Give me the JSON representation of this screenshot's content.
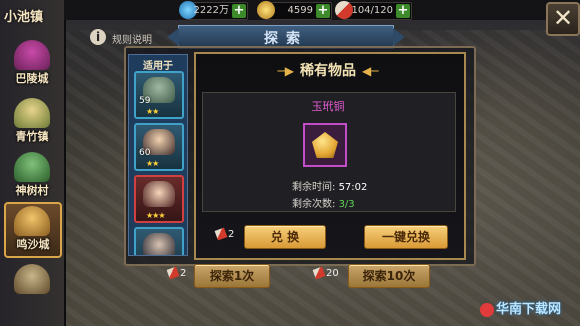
{
  "sidebar": {
    "title": "小池镇",
    "items": [
      {
        "label": "巴陵城"
      },
      {
        "label": "青竹镇"
      },
      {
        "label": "神树村"
      },
      {
        "label": "鸣沙城"
      }
    ]
  },
  "resources": [
    {
      "icon": "diamond-icon",
      "value": "2222万"
    },
    {
      "icon": "coin-icon",
      "value": "4599"
    },
    {
      "icon": "torch-icon",
      "value": "104/120"
    }
  ],
  "header": {
    "info_label": "规则说明",
    "title": "探索",
    "close_label": "✕"
  },
  "heroes": {
    "header": "适用于",
    "cards": [
      {
        "level": "59",
        "stars": "★★"
      },
      {
        "level": "60",
        "stars": "★★"
      },
      {
        "level": "",
        "stars": "★★★"
      },
      {
        "level": "",
        "stars": ""
      }
    ]
  },
  "rare_panel": {
    "title": "稀有物品",
    "item_name": "玉玳铜",
    "time_label": "剩余时间:",
    "time_value": "57:02",
    "count_label": "剩余次数:",
    "count_value": "3/3",
    "exchange_cost": "2",
    "exchange_label": "兑 换",
    "one_click_label": "一键兑换"
  },
  "explore": {
    "cost1": "2",
    "btn1": "探索1次",
    "cost10": "20",
    "btn10": "探索10次"
  },
  "watermark": "华南下载网",
  "colors": {
    "rare_item": "#e35bd2",
    "count": "#5fd45a",
    "accent": "#d99a36"
  }
}
